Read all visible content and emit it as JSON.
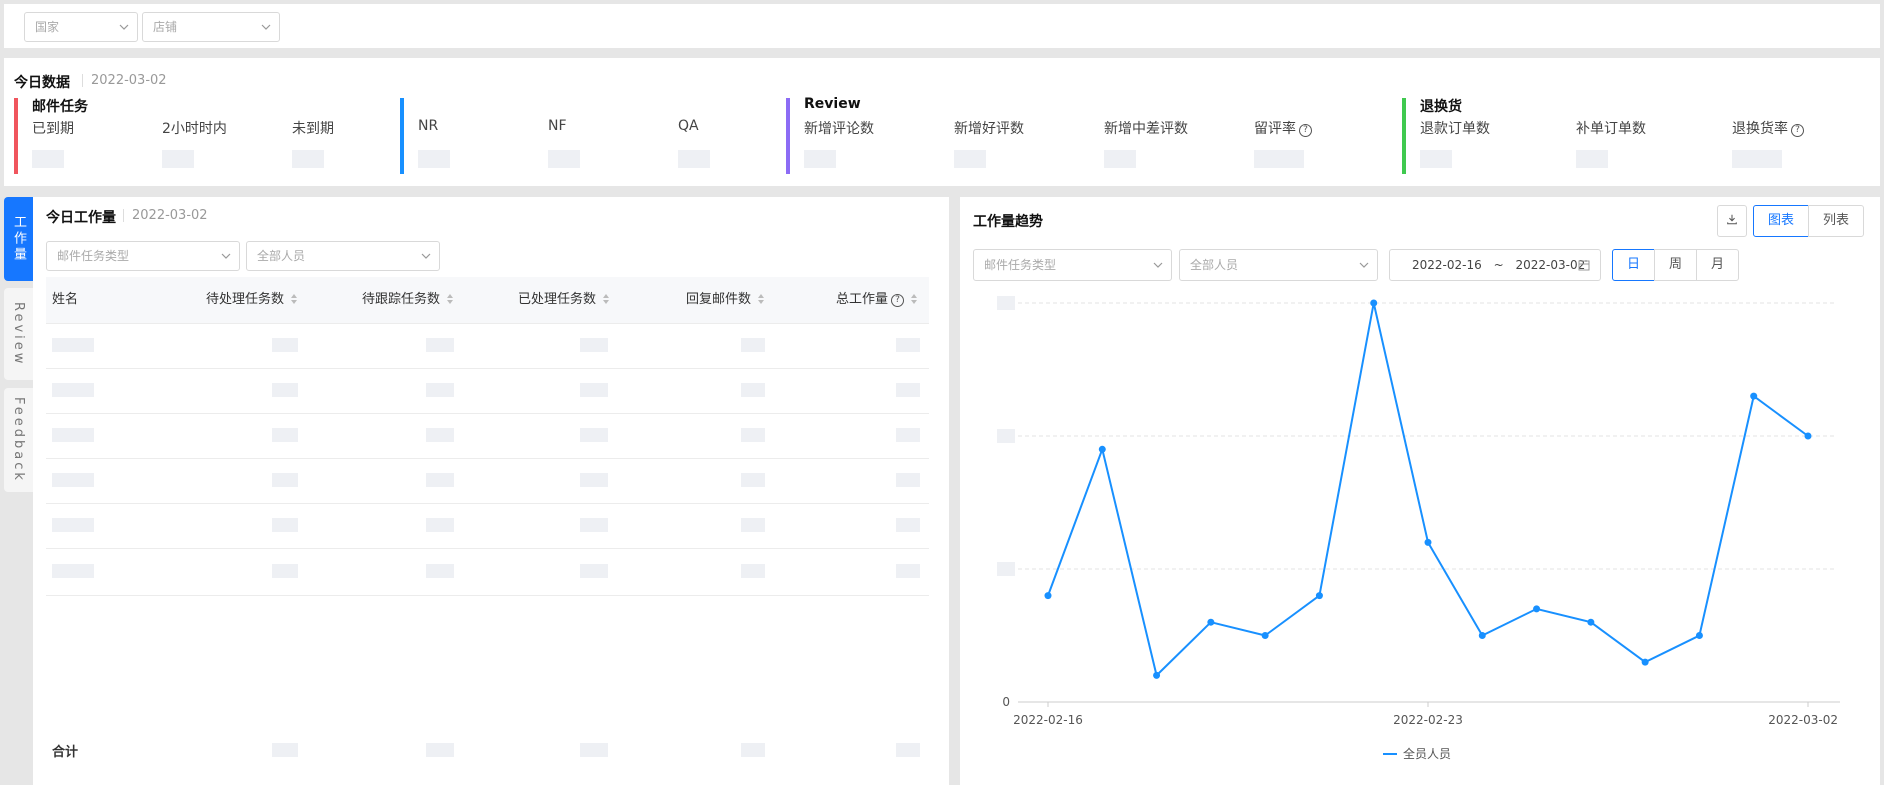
{
  "filters": {
    "country_placeholder": "国家",
    "store_placeholder": "店铺"
  },
  "today": {
    "title": "今日数据",
    "date": "2022-03-02",
    "groups": [
      {
        "title": "邮件任务",
        "color": "#f0555d",
        "items": [
          "已到期",
          "2小时时内",
          "未到期"
        ]
      },
      {
        "title": "",
        "color": "#1890ff",
        "items": [
          "NR",
          "NF",
          "QA"
        ]
      },
      {
        "title": "Review",
        "color": "#8c6cf5",
        "items": [
          "新增评论数",
          "新增好评数",
          "新增中差评数",
          "留评率"
        ]
      },
      {
        "title": "退换货",
        "color": "#3fc94f",
        "items": [
          "退款订单数",
          "补单订单数",
          "退换货率"
        ]
      }
    ]
  },
  "side_tabs": [
    {
      "label": "工作量",
      "active": true
    },
    {
      "label": "Review",
      "active": false
    },
    {
      "label": "Feedback",
      "active": false
    }
  ],
  "workload": {
    "title": "今日工作量",
    "date": "2022-03-02",
    "task_type_placeholder": "邮件任务类型",
    "staff_placeholder": "全部人员",
    "columns": [
      "姓名",
      "待处理任务数",
      "待跟踪任务数",
      "已处理任务数",
      "回复邮件数",
      "总工作量"
    ],
    "total_label": "合计"
  },
  "trend": {
    "title": "工作量趋势",
    "task_type_placeholder": "邮件任务类型",
    "staff_placeholder": "全部人员",
    "date_start": "2022-02-16",
    "date_sep": "~",
    "date_end": "2022-03-02",
    "view_chart": "图表",
    "view_list": "列表",
    "period_day": "日",
    "period_week": "周",
    "period_month": "月"
  },
  "icons": {
    "download": "download-icon",
    "calendar": "calendar-icon",
    "help": "question-circle-icon",
    "chevron": "chevron-down-icon",
    "sort": "sort-icon"
  },
  "colors": {
    "primary": "#1677ff",
    "line": "#1890ff"
  },
  "chart_data": {
    "type": "line",
    "x": [
      "2022-02-16",
      "2022-02-17",
      "2022-02-18",
      "2022-02-19",
      "2022-02-20",
      "2022-02-21",
      "2022-02-22",
      "2022-02-23",
      "2022-02-24",
      "2022-02-25",
      "2022-02-26",
      "2022-02-27",
      "2022-02-28",
      "2022-03-01",
      "2022-03-02"
    ],
    "x_tick_labels": [
      "2022-02-16",
      "2022-02-23",
      "2022-03-02"
    ],
    "y_tick_labels": [
      "0"
    ],
    "series": [
      {
        "name": "全员人员",
        "values": [
          8,
          19,
          2,
          6,
          5,
          8,
          30,
          12,
          5,
          7,
          6,
          3,
          5,
          23,
          20
        ]
      }
    ],
    "ylim": [
      0,
      30
    ],
    "grid": true,
    "legend": "bottom-center"
  }
}
